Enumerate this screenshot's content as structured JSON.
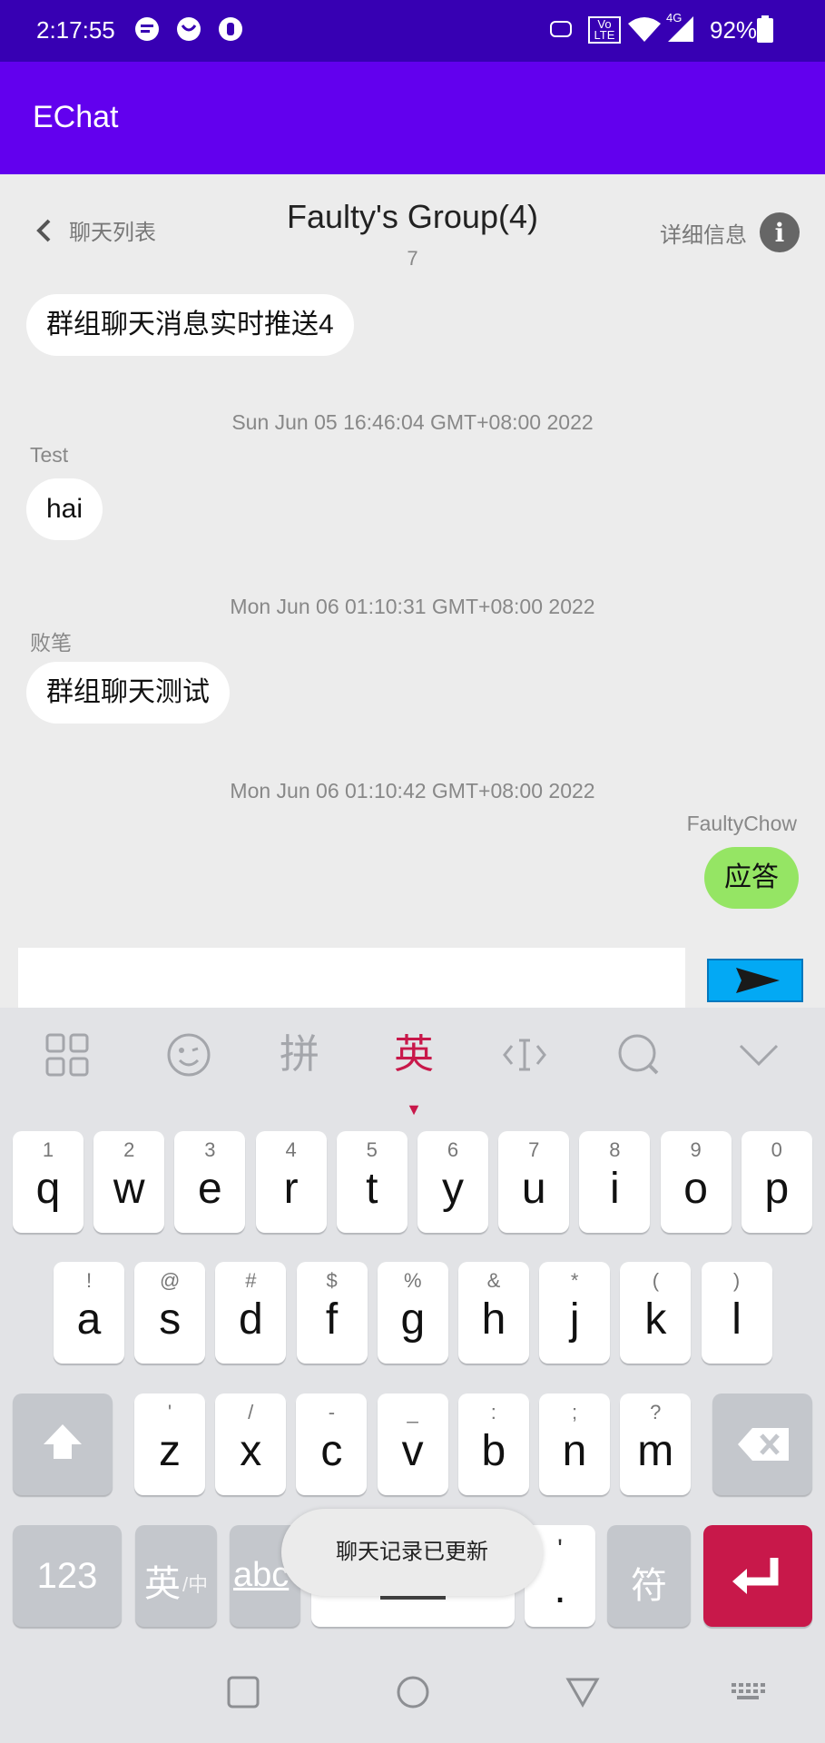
{
  "status_bar": {
    "time": "2:17:55",
    "lte": "Vo LTE",
    "signal": "4G",
    "battery": "92%"
  },
  "app": {
    "title": "EChat"
  },
  "chat_header": {
    "back_label": "聊天列表",
    "title": "Faulty's Group(4)",
    "subtitle": "7",
    "detail_label": "详细信息",
    "info_glyph": "i"
  },
  "messages": [
    {
      "timestamp": "",
      "sender": "",
      "text": "群组聊天消息实时推送4",
      "mine": false
    },
    {
      "timestamp": "Sun Jun 05 16:46:04 GMT+08:00 2022",
      "sender": "Test",
      "text": "hai",
      "mine": false
    },
    {
      "timestamp": "Mon Jun 06 01:10:31 GMT+08:00 2022",
      "sender": "败笔",
      "text": "群组聊天测试",
      "mine": false
    },
    {
      "timestamp": "Mon Jun 06 01:10:42 GMT+08:00 2022",
      "sender": "FaultyChow",
      "text": "应答",
      "mine": true
    }
  ],
  "input": {
    "value": ""
  },
  "keyboard": {
    "toolbar": {
      "pinyin": "拼",
      "english": "英"
    },
    "row1": [
      {
        "num": "1",
        "ltr": "q"
      },
      {
        "num": "2",
        "ltr": "w"
      },
      {
        "num": "3",
        "ltr": "e"
      },
      {
        "num": "4",
        "ltr": "r"
      },
      {
        "num": "5",
        "ltr": "t"
      },
      {
        "num": "6",
        "ltr": "y"
      },
      {
        "num": "7",
        "ltr": "u"
      },
      {
        "num": "8",
        "ltr": "i"
      },
      {
        "num": "9",
        "ltr": "o"
      },
      {
        "num": "0",
        "ltr": "p"
      }
    ],
    "row2": [
      {
        "num": "!",
        "ltr": "a"
      },
      {
        "num": "@",
        "ltr": "s"
      },
      {
        "num": "#",
        "ltr": "d"
      },
      {
        "num": "$",
        "ltr": "f"
      },
      {
        "num": "%",
        "ltr": "g"
      },
      {
        "num": "&",
        "ltr": "h"
      },
      {
        "num": "*",
        "ltr": "j"
      },
      {
        "num": "(",
        "ltr": "k"
      },
      {
        "num": ")",
        "ltr": "l"
      }
    ],
    "row3": [
      {
        "num": "'",
        "ltr": "z"
      },
      {
        "num": "/",
        "ltr": "x"
      },
      {
        "num": "-",
        "ltr": "c"
      },
      {
        "num": "_",
        "ltr": "v"
      },
      {
        "num": ":",
        "ltr": "b"
      },
      {
        "num": ";",
        "ltr": "n"
      },
      {
        "num": "?",
        "ltr": "m"
      }
    ],
    "row4": {
      "numbers": "123",
      "lang": "英",
      "lang_sub": "/中",
      "abc": "abc",
      "comma": "'",
      "period": ".",
      "symbols": "符"
    }
  },
  "toast": "聊天记录已更新"
}
